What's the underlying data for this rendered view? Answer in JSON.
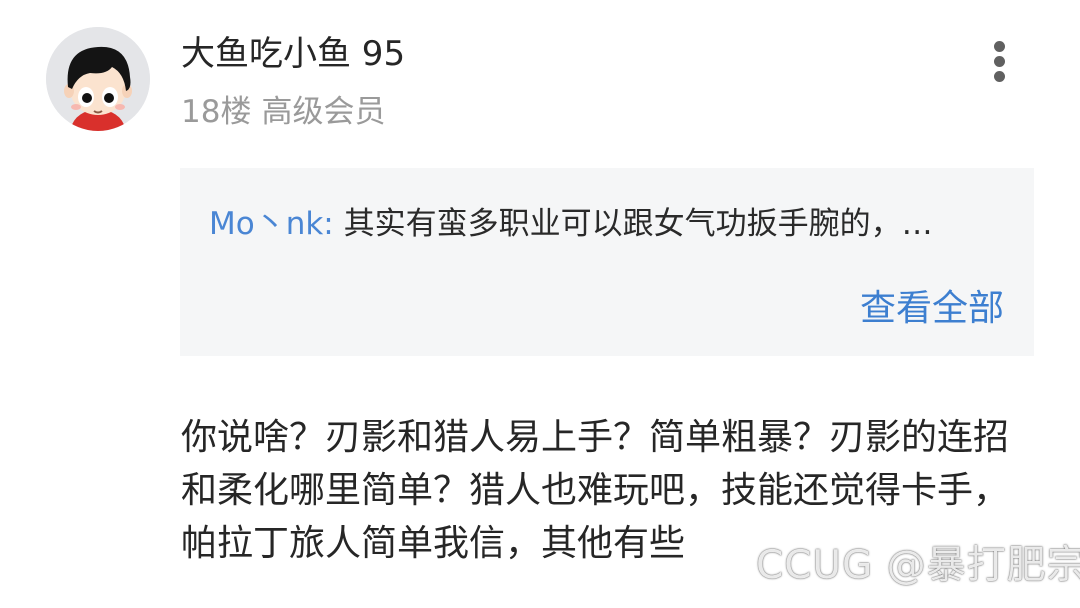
{
  "post": {
    "username": "大鱼吃小鱼 95",
    "floor": "18楼",
    "member_level": "高级会员",
    "avatar_icon": "cartoon-boy-avatar",
    "more_icon": "vertical-dots-icon",
    "quote": {
      "author": "Mo丶nk:",
      "text": "其实有蛮多职业可以跟女气功扳手腕的，…",
      "view_all_label": "查看全部"
    },
    "content": "你说啥？刃影和猎人易上手？简单粗暴？刃影的连招和柔化哪里简单？猎人也难玩吧，技能还觉得卡手，帕拉丁旅人简单我信，其他有些"
  },
  "watermark": "CCUG @暴打肥宗",
  "colors": {
    "link_blue": "#3d7fd0",
    "quote_author_blue": "#4a86d4",
    "quote_background": "#f5f6f7",
    "text_primary": "#262626",
    "text_secondary": "#9a9a9a"
  }
}
